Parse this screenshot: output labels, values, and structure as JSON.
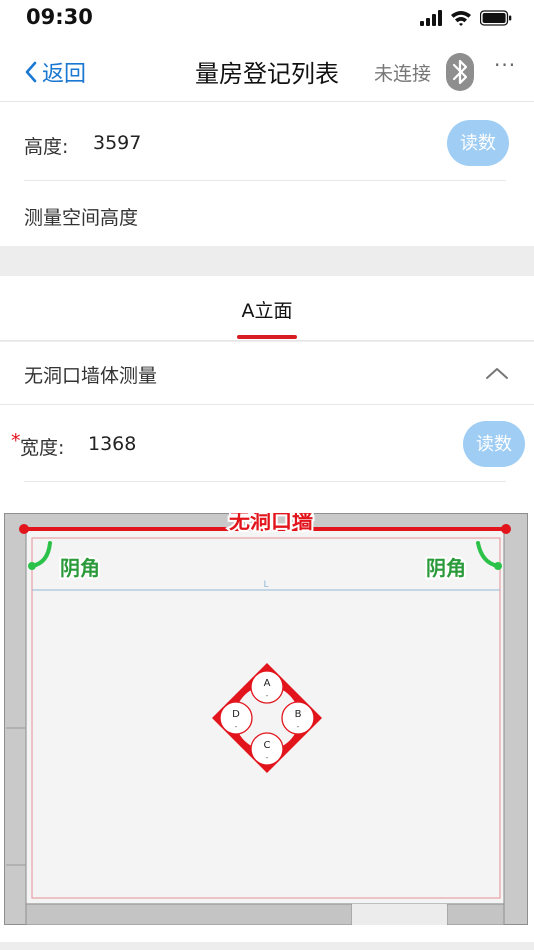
{
  "status_bar": {
    "time": "09:30"
  },
  "nav": {
    "back_label": "返回",
    "title": "量房登记列表",
    "connection_status": "未连接"
  },
  "height_section": {
    "label": "高度:",
    "value": "3597",
    "read_button": "读数",
    "description": "测量空间高度"
  },
  "tab": {
    "label": "A立面"
  },
  "wall_section": {
    "title": "无洞口墙体测量",
    "width_required_mark": "*",
    "width_label": "宽度:",
    "width_value": "1368",
    "read_button": "读数"
  },
  "diagram": {
    "wall_label": "无洞口墙",
    "left_corner_label": "阴角",
    "right_corner_label": "阴角",
    "dimension_mark": "L",
    "points": [
      {
        "name": "A",
        "value": "-"
      },
      {
        "name": "B",
        "value": "-"
      },
      {
        "name": "C",
        "value": "-"
      },
      {
        "name": "D",
        "value": "-"
      }
    ]
  },
  "colors": {
    "accent_blue": "#1a78d2",
    "button_blue": "#9fcdf4",
    "wall_red": "#e2141c",
    "corner_green": "#2cc24a"
  }
}
